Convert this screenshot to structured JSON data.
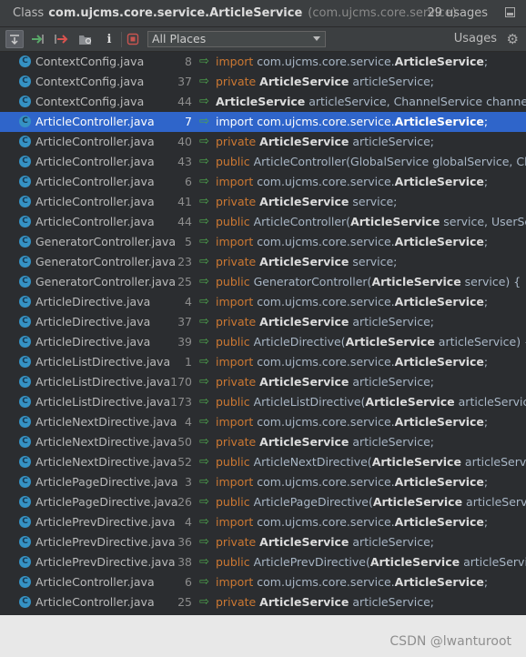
{
  "title": {
    "kind": "Class",
    "name": "com.ujcms.core.service.ArticleService",
    "package": "(com.ujcms.core.service)",
    "count": "29 usages"
  },
  "toolbar": {
    "scope": "All Places",
    "usages_label": "Usages",
    "icons": [
      "expand-icon",
      "next-occurrence-icon",
      "previous-occurrence-icon",
      "open-in-find-window-icon",
      "info-icon",
      "stop-icon"
    ]
  },
  "rows": [
    {
      "file": "ContextConfig.java",
      "line": "8",
      "parts": [
        [
          "kw",
          "import "
        ],
        [
          "t",
          "com.ujcms.core.service."
        ],
        [
          "cls",
          "ArticleService"
        ],
        [
          "t",
          ";"
        ]
      ]
    },
    {
      "file": "ContextConfig.java",
      "line": "37",
      "parts": [
        [
          "kw",
          "private "
        ],
        [
          "cls",
          "ArticleService"
        ],
        [
          "t",
          " articleService;"
        ]
      ]
    },
    {
      "file": "ContextConfig.java",
      "line": "44",
      "parts": [
        [
          "cls",
          "ArticleService"
        ],
        [
          "t",
          " articleService, ChannelService channelService"
        ]
      ]
    },
    {
      "file": "ArticleController.java",
      "line": "7",
      "selected": true,
      "parts": [
        [
          "kw",
          "import "
        ],
        [
          "t",
          "com.ujcms.core.service."
        ],
        [
          "cls",
          "ArticleService"
        ],
        [
          "t",
          ";"
        ]
      ]
    },
    {
      "file": "ArticleController.java",
      "line": "40",
      "parts": [
        [
          "kw",
          "private "
        ],
        [
          "cls",
          "ArticleService"
        ],
        [
          "t",
          " articleService;"
        ]
      ]
    },
    {
      "file": "ArticleController.java",
      "line": "43",
      "parts": [
        [
          "kw",
          "public "
        ],
        [
          "t",
          "ArticleController(GlobalService globalService, Chann"
        ]
      ]
    },
    {
      "file": "ArticleController.java",
      "line": "6",
      "parts": [
        [
          "kw",
          "import "
        ],
        [
          "t",
          "com.ujcms.core.service."
        ],
        [
          "cls",
          "ArticleService"
        ],
        [
          "t",
          ";"
        ]
      ]
    },
    {
      "file": "ArticleController.java",
      "line": "41",
      "parts": [
        [
          "kw",
          "private "
        ],
        [
          "cls",
          "ArticleService"
        ],
        [
          "t",
          " service;"
        ]
      ]
    },
    {
      "file": "ArticleController.java",
      "line": "44",
      "parts": [
        [
          "kw",
          "public "
        ],
        [
          "t",
          "ArticleController("
        ],
        [
          "cls",
          "ArticleService"
        ],
        [
          "t",
          " service, UserService"
        ]
      ]
    },
    {
      "file": "GeneratorController.java",
      "line": "5",
      "parts": [
        [
          "kw",
          "import "
        ],
        [
          "t",
          "com.ujcms.core.service."
        ],
        [
          "cls",
          "ArticleService"
        ],
        [
          "t",
          ";"
        ]
      ]
    },
    {
      "file": "GeneratorController.java",
      "line": "23",
      "parts": [
        [
          "kw",
          "private "
        ],
        [
          "cls",
          "ArticleService"
        ],
        [
          "t",
          " service;"
        ]
      ]
    },
    {
      "file": "GeneratorController.java",
      "line": "25",
      "parts": [
        [
          "kw",
          "public "
        ],
        [
          "t",
          "GeneratorController("
        ],
        [
          "cls",
          "ArticleService"
        ],
        [
          "t",
          " service) {"
        ]
      ]
    },
    {
      "file": "ArticleDirective.java",
      "line": "4",
      "parts": [
        [
          "kw",
          "import "
        ],
        [
          "t",
          "com.ujcms.core.service."
        ],
        [
          "cls",
          "ArticleService"
        ],
        [
          "t",
          ";"
        ]
      ]
    },
    {
      "file": "ArticleDirective.java",
      "line": "37",
      "parts": [
        [
          "kw",
          "private "
        ],
        [
          "cls",
          "ArticleService"
        ],
        [
          "t",
          " articleService;"
        ]
      ]
    },
    {
      "file": "ArticleDirective.java",
      "line": "39",
      "parts": [
        [
          "kw",
          "public "
        ],
        [
          "t",
          "ArticleDirective("
        ],
        [
          "cls",
          "ArticleService"
        ],
        [
          "t",
          " articleService) {"
        ]
      ]
    },
    {
      "file": "ArticleListDirective.java",
      "line": "1",
      "parts": [
        [
          "kw",
          "import "
        ],
        [
          "t",
          "com.ujcms.core.service."
        ],
        [
          "cls",
          "ArticleService"
        ],
        [
          "t",
          ";"
        ]
      ]
    },
    {
      "file": "ArticleListDirective.java",
      "line": "170",
      "parts": [
        [
          "kw",
          "private "
        ],
        [
          "cls",
          "ArticleService"
        ],
        [
          "t",
          " articleService;"
        ]
      ]
    },
    {
      "file": "ArticleListDirective.java",
      "line": "173",
      "parts": [
        [
          "kw",
          "public "
        ],
        [
          "t",
          "ArticleListDirective("
        ],
        [
          "cls",
          "ArticleService"
        ],
        [
          "t",
          " articleService, Cha"
        ]
      ]
    },
    {
      "file": "ArticleNextDirective.java",
      "line": "4",
      "parts": [
        [
          "kw",
          "import "
        ],
        [
          "t",
          "com.ujcms.core.service."
        ],
        [
          "cls",
          "ArticleService"
        ],
        [
          "t",
          ";"
        ]
      ]
    },
    {
      "file": "ArticleNextDirective.java",
      "line": "50",
      "parts": [
        [
          "kw",
          "private "
        ],
        [
          "cls",
          "ArticleService"
        ],
        [
          "t",
          " articleService;"
        ]
      ]
    },
    {
      "file": "ArticleNextDirective.java",
      "line": "52",
      "parts": [
        [
          "kw",
          "public "
        ],
        [
          "t",
          "ArticleNextDirective("
        ],
        [
          "cls",
          "ArticleService"
        ],
        [
          "t",
          " articleService) {"
        ]
      ]
    },
    {
      "file": "ArticlePageDirective.java",
      "line": "3",
      "parts": [
        [
          "kw",
          "import "
        ],
        [
          "t",
          "com.ujcms.core.service."
        ],
        [
          "cls",
          "ArticleService"
        ],
        [
          "t",
          ";"
        ]
      ]
    },
    {
      "file": "ArticlePageDirective.java",
      "line": "26",
      "parts": [
        [
          "kw",
          "public "
        ],
        [
          "t",
          "ArticlePageDirective("
        ],
        [
          "cls",
          "ArticleService"
        ],
        [
          "t",
          " articleService, Ch"
        ]
      ]
    },
    {
      "file": "ArticlePrevDirective.java",
      "line": "4",
      "parts": [
        [
          "kw",
          "import "
        ],
        [
          "t",
          "com.ujcms.core.service."
        ],
        [
          "cls",
          "ArticleService"
        ],
        [
          "t",
          ";"
        ]
      ]
    },
    {
      "file": "ArticlePrevDirective.java",
      "line": "36",
      "parts": [
        [
          "kw",
          "private "
        ],
        [
          "cls",
          "ArticleService"
        ],
        [
          "t",
          " articleService;"
        ]
      ]
    },
    {
      "file": "ArticlePrevDirective.java",
      "line": "38",
      "parts": [
        [
          "kw",
          "public "
        ],
        [
          "t",
          "ArticlePrevDirective("
        ],
        [
          "cls",
          "ArticleService"
        ],
        [
          "t",
          " articleService) {"
        ]
      ]
    },
    {
      "file": "ArticleController.java",
      "line": "6",
      "parts": [
        [
          "kw",
          "import "
        ],
        [
          "t",
          "com.ujcms.core.service."
        ],
        [
          "cls",
          "ArticleService"
        ],
        [
          "t",
          ";"
        ]
      ]
    },
    {
      "file": "ArticleController.java",
      "line": "25",
      "parts": [
        [
          "kw",
          "private "
        ],
        [
          "cls",
          "ArticleService"
        ],
        [
          "t",
          " articleService;"
        ]
      ]
    }
  ],
  "watermark": "CSDN @lwanturoot",
  "colors": {
    "background": "#2b2d30",
    "selection": "#2f65ca",
    "keyword": "#cc7832",
    "class_icon": "#3592c4",
    "usage_arrow": "#4da64d"
  }
}
